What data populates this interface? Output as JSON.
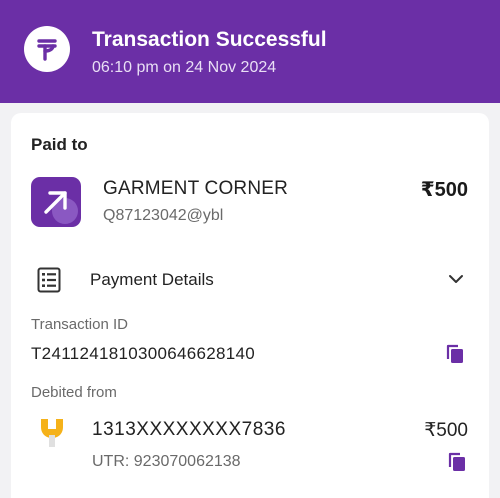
{
  "header": {
    "title": "Transaction Successful",
    "time": "06:10 pm on 24 Nov 2024",
    "logo_icon": "phonepe-logo-icon",
    "bg_color": "#6b2fa6"
  },
  "paid_to": {
    "label": "Paid to",
    "merchant_name": "GARMENT CORNER",
    "merchant_upi": "Q87123042@ybl",
    "amount": "₹500",
    "icon": "arrow-up-right-icon"
  },
  "payment_details": {
    "label": "Payment Details",
    "icon": "receipt-list-icon",
    "toggle_icon": "chevron-down-icon"
  },
  "transaction": {
    "id_label": "Transaction ID",
    "id_value": "T2411241810300646628140",
    "copy_icon": "copy-icon"
  },
  "debited_from": {
    "label": "Debited from",
    "account": "1313XXXXXXXX7836",
    "amount": "₹500",
    "utr": "UTR: 923070062138",
    "bank_icon": "bank-logo-icon",
    "copy_icon": "copy-icon"
  }
}
